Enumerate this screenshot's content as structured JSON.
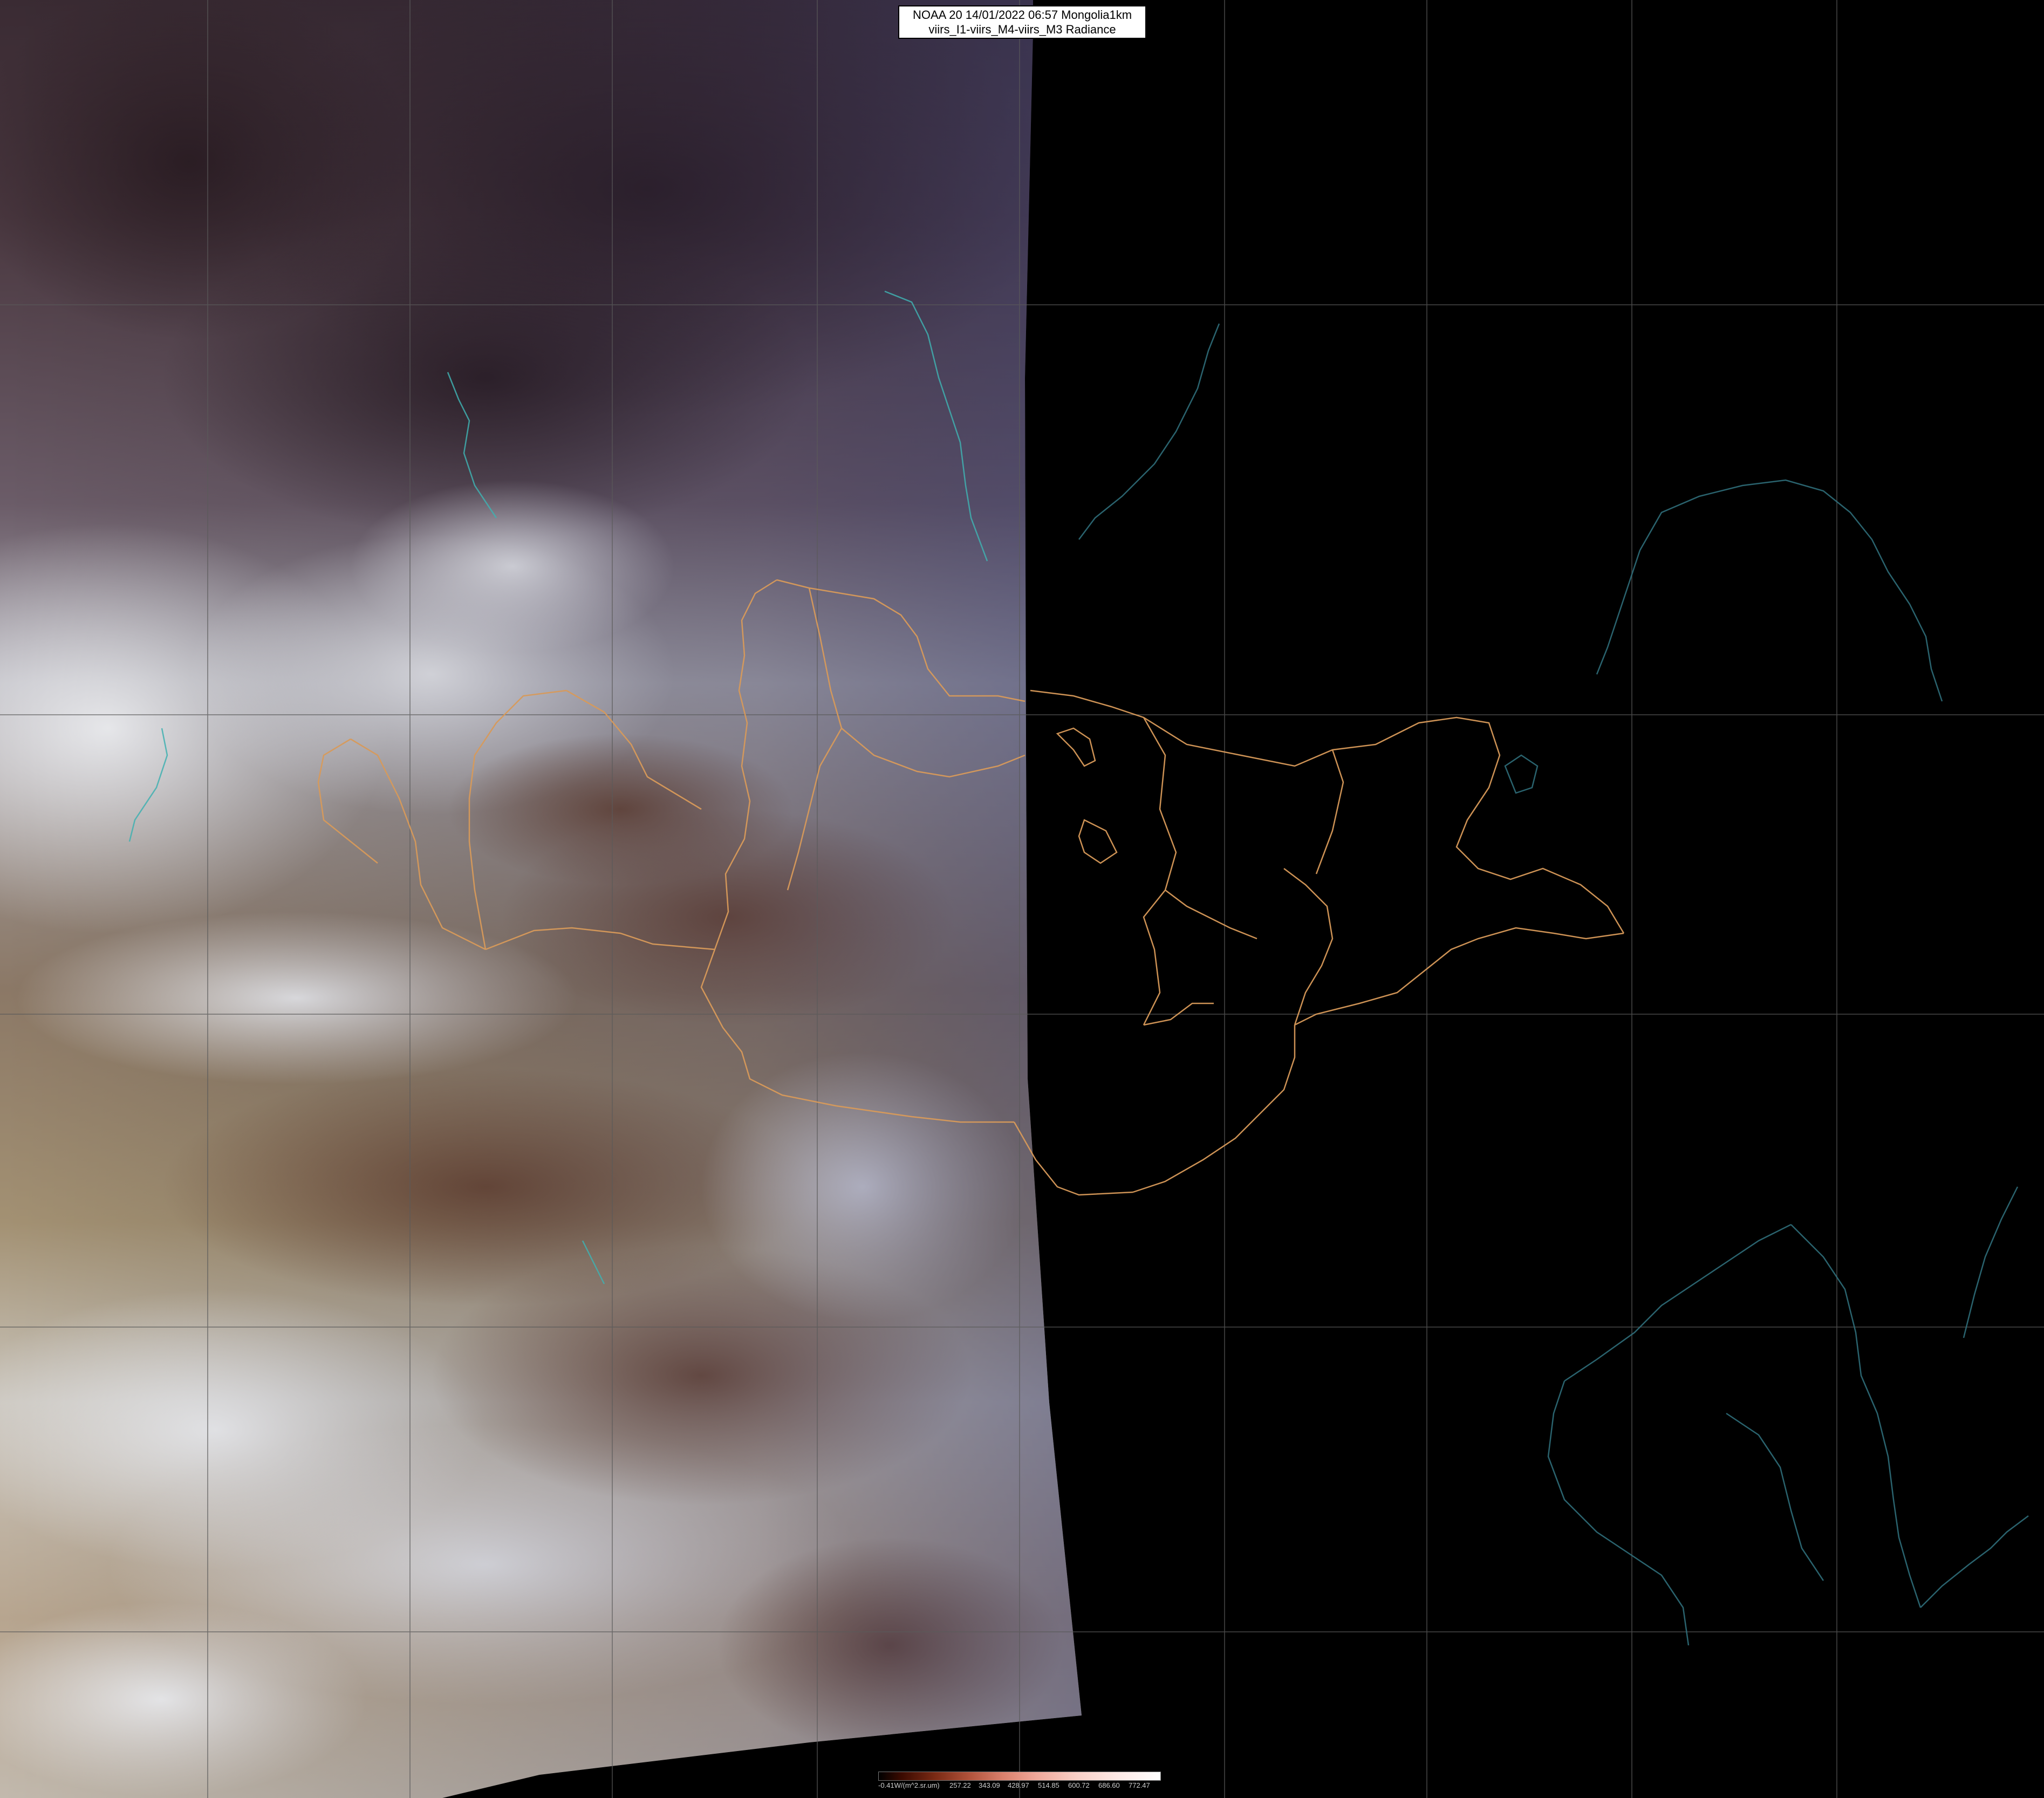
{
  "header": {
    "line1": "NOAA 20 14/01/2022 06:57 Mongolia1km",
    "line2": "viirs_I1-viirs_M4-viirs_M3 Radiance"
  },
  "legend": {
    "unit_label": "-0.41W/(m^2.sr.um)",
    "ticks": [
      "257.22",
      "343.09",
      "428.97",
      "514.85",
      "600.72",
      "686.60",
      "772.47"
    ]
  },
  "colors": {
    "night_side": "#000000",
    "province_borders": "#d89a5a",
    "coastlines_night": "#2f6e7a",
    "graticule": "#5a5a5a",
    "water_features": "#3fb0b0"
  }
}
